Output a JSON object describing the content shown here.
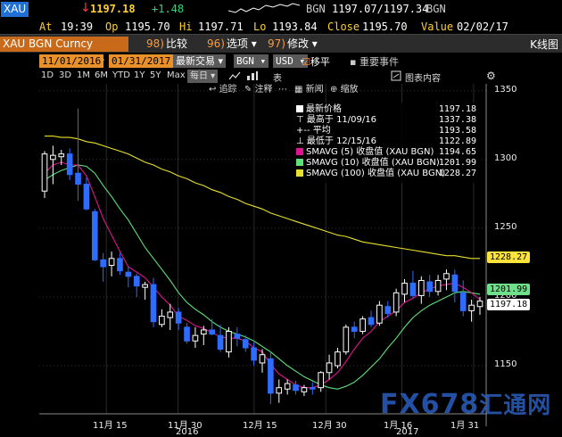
{
  "quote": {
    "ticker": "XAU",
    "direction_arrow": "↓",
    "last": "1197.18",
    "change": "+1.48",
    "source": "BGN",
    "bid_ask": "1197.07/1197.34",
    "source2": "BGN"
  },
  "stats": {
    "at_label": "At",
    "at_value": "19:39",
    "op_label": "Op",
    "op_value": "1195.70",
    "hi_label": "Hi",
    "hi_value": "1197.71",
    "lo_label": "Lo",
    "lo_value": "1193.84",
    "close_label": "Close",
    "close_value": "1195.70",
    "value_label": "Value",
    "value_value": "02/02/17"
  },
  "toolbar": {
    "security": "XAU BGN Curncy",
    "compare_num": "98)",
    "compare_label": "比较",
    "options_num": "96)",
    "options_label": "选项",
    "modify_num": "97)",
    "modify_label": "修改",
    "chart_title": "K线图"
  },
  "daterow": {
    "start_date": "11/01/2016",
    "end_date": "01/31/2017",
    "trade_mode": "最新交易",
    "source": "BGN",
    "currency": "USD",
    "move_label": "移平",
    "events_label": "重要事件"
  },
  "periods": [
    "1D",
    "3D",
    "1M",
    "6M",
    "YTD",
    "1Y",
    "5Y",
    "Max",
    "每日"
  ],
  "chartbar": {
    "table_label": "表",
    "content_label": "图表内容"
  },
  "chartbar2": {
    "back_label": "追踪",
    "notes_label": "注释",
    "news_label": "新闻",
    "zoom_label": "缩放"
  },
  "legend": {
    "last_price_label": "最新价格",
    "last_price_value": "1197.18",
    "high_label": "最高于 11/09/16",
    "high_value": "1337.38",
    "avg_label": "平均",
    "avg_value": "1193.58",
    "low_label": "最低于 12/15/16",
    "low_value": "1122.89",
    "sma5_label": "SMAVG (5) 收盘值 (XAU BGN)",
    "sma5_value": "1194.65",
    "sma10_label": "SMAVG (10) 收盘值 (XAU BGN)",
    "sma10_value": "1201.99",
    "sma100_label": "SMAVG (100) 收盘值 (XAU BGN)",
    "sma100_value": "1228.27"
  },
  "colors": {
    "up": "#ffffff",
    "down": "#2e6cff",
    "sma5": "#e0138f",
    "sma10": "#5fe07a",
    "sma100": "#e8e02a",
    "last_badge": "#ffffff",
    "sma100_badge": "#ffe23a",
    "sma10_badge": "#6fe08a"
  },
  "badges": {
    "sma100": "1228.27",
    "sma10": "1201.99",
    "last": "1197.18"
  },
  "chart_data": {
    "type": "candlestick",
    "title": "",
    "y_ticks": [
      "1350",
      "1300",
      "1250",
      "1200",
      "1150"
    ],
    "ylim": [
      1115,
      1355
    ],
    "x_ticks": [
      "11月 15",
      "11月 30",
      "12月 15",
      "12月 30",
      "1月 16",
      "1月 31"
    ],
    "year_labels": [
      "2016",
      "2017"
    ],
    "grid": true,
    "candles": [
      {
        "o": 1277,
        "h": 1306,
        "l": 1272,
        "c": 1304
      },
      {
        "o": 1300,
        "h": 1310,
        "l": 1282,
        "c": 1303
      },
      {
        "o": 1302,
        "h": 1307,
        "l": 1296,
        "c": 1304
      },
      {
        "o": 1304,
        "h": 1308,
        "l": 1285,
        "c": 1289
      },
      {
        "o": 1290,
        "h": 1337,
        "l": 1270,
        "c": 1282
      },
      {
        "o": 1282,
        "h": 1287,
        "l": 1263,
        "c": 1264
      },
      {
        "o": 1262,
        "h": 1264,
        "l": 1226,
        "c": 1227
      },
      {
        "o": 1227,
        "h": 1232,
        "l": 1211,
        "c": 1222
      },
      {
        "o": 1223,
        "h": 1233,
        "l": 1215,
        "c": 1228
      },
      {
        "o": 1228,
        "h": 1232,
        "l": 1216,
        "c": 1219
      },
      {
        "o": 1218,
        "h": 1222,
        "l": 1207,
        "c": 1215
      },
      {
        "o": 1215,
        "h": 1217,
        "l": 1200,
        "c": 1208
      },
      {
        "o": 1207,
        "h": 1211,
        "l": 1198,
        "c": 1209
      },
      {
        "o": 1209,
        "h": 1214,
        "l": 1178,
        "c": 1182
      },
      {
        "o": 1180,
        "h": 1191,
        "l": 1178,
        "c": 1186
      },
      {
        "o": 1185,
        "h": 1195,
        "l": 1176,
        "c": 1189
      },
      {
        "o": 1189,
        "h": 1192,
        "l": 1176,
        "c": 1181
      },
      {
        "o": 1178,
        "h": 1181,
        "l": 1166,
        "c": 1168
      },
      {
        "o": 1168,
        "h": 1178,
        "l": 1163,
        "c": 1172
      },
      {
        "o": 1173,
        "h": 1179,
        "l": 1165,
        "c": 1176
      },
      {
        "o": 1176,
        "h": 1184,
        "l": 1172,
        "c": 1173
      },
      {
        "o": 1172,
        "h": 1180,
        "l": 1160,
        "c": 1162
      },
      {
        "o": 1160,
        "h": 1178,
        "l": 1156,
        "c": 1175
      },
      {
        "o": 1173,
        "h": 1178,
        "l": 1164,
        "c": 1170
      },
      {
        "o": 1169,
        "h": 1172,
        "l": 1160,
        "c": 1163
      },
      {
        "o": 1163,
        "h": 1167,
        "l": 1150,
        "c": 1154
      },
      {
        "o": 1152,
        "h": 1162,
        "l": 1145,
        "c": 1158
      },
      {
        "o": 1155,
        "h": 1160,
        "l": 1122,
        "c": 1130
      },
      {
        "o": 1130,
        "h": 1140,
        "l": 1123,
        "c": 1134
      },
      {
        "o": 1133,
        "h": 1140,
        "l": 1129,
        "c": 1137
      },
      {
        "o": 1136,
        "h": 1139,
        "l": 1129,
        "c": 1132
      },
      {
        "o": 1131,
        "h": 1136,
        "l": 1128,
        "c": 1134
      },
      {
        "o": 1134,
        "h": 1138,
        "l": 1129,
        "c": 1133
      },
      {
        "o": 1134,
        "h": 1146,
        "l": 1131,
        "c": 1145
      },
      {
        "o": 1145,
        "h": 1158,
        "l": 1140,
        "c": 1152
      },
      {
        "o": 1150,
        "h": 1163,
        "l": 1148,
        "c": 1160
      },
      {
        "o": 1160,
        "h": 1180,
        "l": 1158,
        "c": 1178
      },
      {
        "o": 1178,
        "h": 1182,
        "l": 1170,
        "c": 1175
      },
      {
        "o": 1175,
        "h": 1186,
        "l": 1173,
        "c": 1184
      },
      {
        "o": 1185,
        "h": 1190,
        "l": 1178,
        "c": 1180
      },
      {
        "o": 1181,
        "h": 1197,
        "l": 1179,
        "c": 1194
      },
      {
        "o": 1193,
        "h": 1197,
        "l": 1185,
        "c": 1188
      },
      {
        "o": 1189,
        "h": 1206,
        "l": 1186,
        "c": 1203
      },
      {
        "o": 1202,
        "h": 1213,
        "l": 1196,
        "c": 1210
      },
      {
        "o": 1210,
        "h": 1219,
        "l": 1199,
        "c": 1201
      },
      {
        "o": 1201,
        "h": 1215,
        "l": 1195,
        "c": 1212
      },
      {
        "o": 1211,
        "h": 1216,
        "l": 1200,
        "c": 1204
      },
      {
        "o": 1204,
        "h": 1216,
        "l": 1201,
        "c": 1212
      },
      {
        "o": 1213,
        "h": 1220,
        "l": 1205,
        "c": 1217
      },
      {
        "o": 1216,
        "h": 1220,
        "l": 1196,
        "c": 1204
      },
      {
        "o": 1203,
        "h": 1212,
        "l": 1186,
        "c": 1190
      },
      {
        "o": 1190,
        "h": 1198,
        "l": 1182,
        "c": 1194
      },
      {
        "o": 1193,
        "h": 1200,
        "l": 1187,
        "c": 1197
      }
    ],
    "sma5": [
      1290,
      1296,
      1298,
      1296,
      1296,
      1288,
      1273,
      1257,
      1245,
      1233,
      1222,
      1218,
      1214,
      1207,
      1200,
      1194,
      1186,
      1183,
      1179,
      1177,
      1174,
      1171,
      1170,
      1170,
      1168,
      1163,
      1160,
      1151,
      1144,
      1140,
      1136,
      1134,
      1134,
      1136,
      1140,
      1145,
      1153,
      1162,
      1170,
      1175,
      1182,
      1186,
      1190,
      1196,
      1199,
      1203,
      1206,
      1208,
      1209,
      1210,
      1207,
      1203,
      1198
    ],
    "sma10": [
      1285,
      1289,
      1292,
      1294,
      1296,
      1295,
      1290,
      1281,
      1273,
      1264,
      1256,
      1246,
      1236,
      1228,
      1220,
      1212,
      1203,
      1196,
      1191,
      1187,
      1182,
      1178,
      1175,
      1173,
      1171,
      1168,
      1164,
      1160,
      1155,
      1150,
      1146,
      1142,
      1139,
      1136,
      1134,
      1133,
      1135,
      1138,
      1143,
      1149,
      1155,
      1163,
      1170,
      1178,
      1185,
      1190,
      1194,
      1197,
      1200,
      1203,
      1204,
      1203,
      1202
    ],
    "sma100": [
      1317,
      1317,
      1316,
      1316,
      1315,
      1313,
      1312,
      1310,
      1308,
      1306,
      1304,
      1301,
      1298,
      1296,
      1293,
      1291,
      1288,
      1286,
      1283,
      1281,
      1278,
      1276,
      1273,
      1271,
      1268,
      1266,
      1264,
      1261,
      1259,
      1257,
      1255,
      1253,
      1251,
      1249,
      1247,
      1245,
      1244,
      1242,
      1240,
      1239,
      1238,
      1237,
      1236,
      1235,
      1234,
      1233,
      1232,
      1231,
      1230,
      1230,
      1229,
      1228,
      1228
    ]
  },
  "watermark": {
    "brand": "FX678",
    "brand2": "汇通网"
  }
}
